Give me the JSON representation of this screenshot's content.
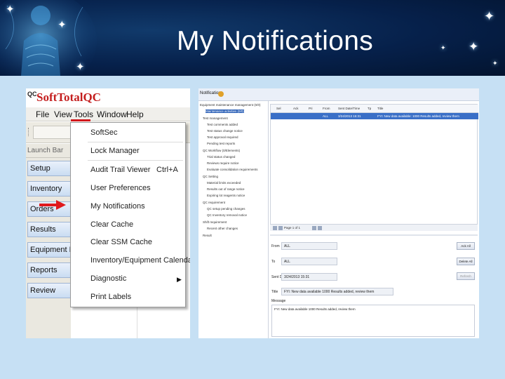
{
  "slide": {
    "title": "My Notifications",
    "colors": {
      "header_bg": "#06204a",
      "body_bg": "#c6e0f4",
      "accent_red": "#d2171b"
    }
  },
  "left_app": {
    "logo_badge": "QC",
    "app_name": "SoftTotalQC",
    "menu": [
      "File",
      "View",
      "Tools",
      "Window",
      "Help"
    ],
    "launch_bar": "Launch Bar",
    "sidebar": [
      "Setup",
      "Inventory",
      "Orders",
      "Results",
      "Equipment Mar",
      "Reports",
      "Review"
    ],
    "dropdown": [
      {
        "label": "SoftSec"
      },
      {
        "label": "Lock Manager"
      },
      {
        "label": "Audit Trail Viewer",
        "shortcut": "Ctrl+A"
      },
      {
        "label": "User Preferences"
      },
      {
        "label": "My Notifications",
        "highlighted_by_arrow": true
      },
      {
        "label": "Clear Cache"
      },
      {
        "label": "Clear SSM Cache"
      },
      {
        "label": "Inventory/Equipment Calendar"
      },
      {
        "label": "Diagnostic",
        "submenu": true
      },
      {
        "label": "Print Labels"
      }
    ]
  },
  "right_app": {
    "window_title": "Notifications",
    "tree": [
      "Equipment maintenance management (0/0)",
      "Maintenance activities (0/0)",
      "Test management",
      "Test comments added",
      "Test status change notice",
      "Test approval required",
      "Pending test reports",
      "QC Workflow (0/Elements)",
      "Trial status changed",
      "Reviews require notice",
      "Evaluate consolidation requirements",
      "QC Setting",
      "Material limits exceeded",
      "Results out of range notice",
      "Expiring lot reagents notice",
      "QC requirement",
      "QC setup pending changes",
      "QC Inventory removal notice",
      "Shift requirement",
      "Recent other changes",
      "Result"
    ],
    "columns": [
      "Sel",
      "Ack",
      "Pri",
      "From",
      "Sent Date/Time",
      "Tp",
      "Title"
    ],
    "row": [
      "",
      "",
      "",
      "ALL",
      "3/24/2013 15:31",
      "",
      "FYI: New data available: 1000 Results added, review them"
    ],
    "pager_text": "Page 1 of 1",
    "fields": [
      {
        "label": "From",
        "value": "ALL"
      },
      {
        "label": "To",
        "value": "ALL"
      },
      {
        "label": "Sent Date",
        "value": "3/24/2013 15:31"
      },
      {
        "label": "Title",
        "value": "FYI: New data available 1000 Results added, review them"
      }
    ],
    "message_label": "Message",
    "message": "FYI: New data available 1000 Results added, review them",
    "buttons": [
      "Ack All",
      "Delete All",
      "Refresh"
    ]
  }
}
